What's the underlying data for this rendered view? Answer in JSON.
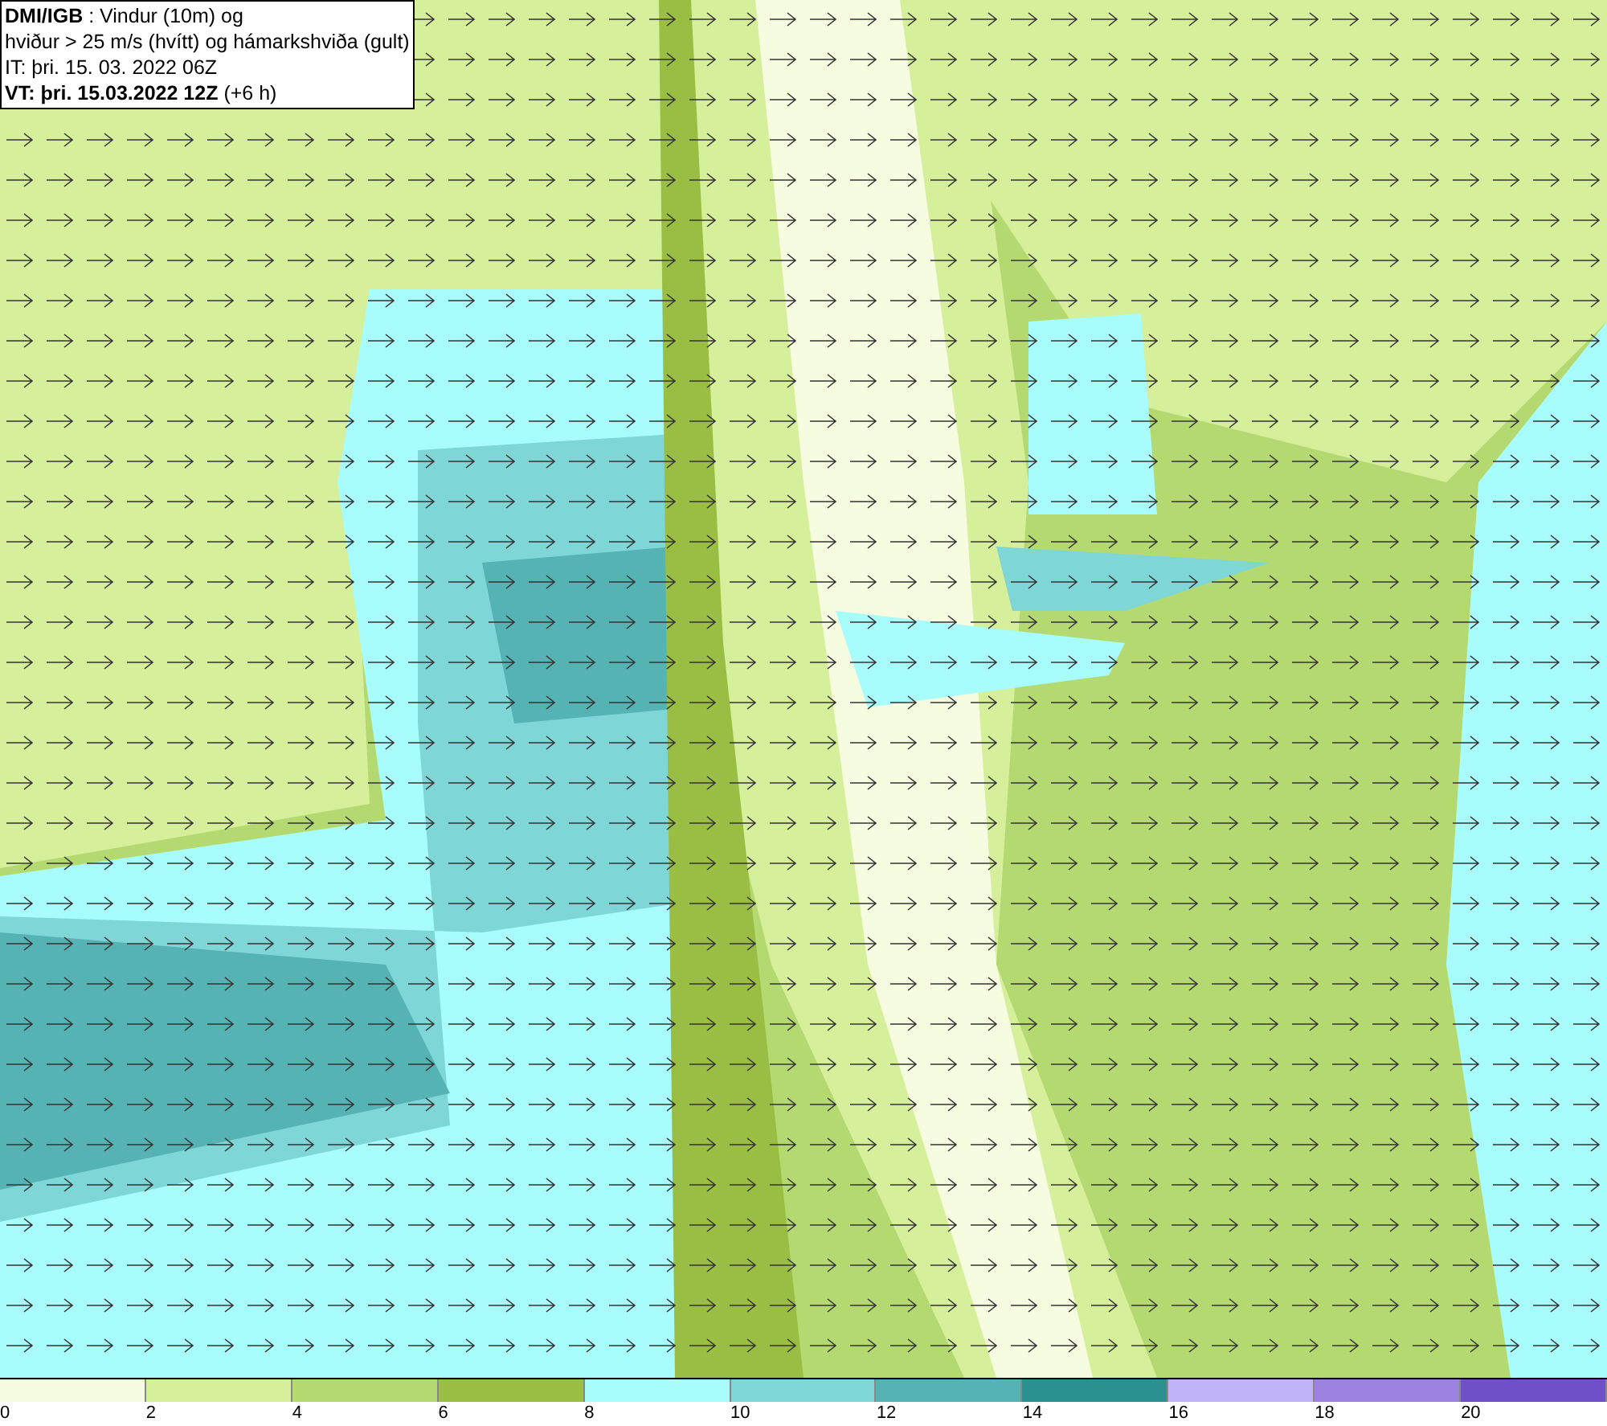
{
  "header": {
    "lines": [
      "**DMI/IGB** : Vindur (10m) og",
      "hviður > 25 m/s (hvítt) og hámarkshviða (gult)",
      "IT: þri. 15. 03. 2022 06Z",
      "**VT: þri. 15.03.2022 12Z** (+6 h)"
    ]
  },
  "legend": [
    {
      "label": "0",
      "color": "#f5fce0"
    },
    {
      "label": "2",
      "color": "#d6ef9a"
    },
    {
      "label": "4",
      "color": "#b5d971"
    },
    {
      "label": "6",
      "color": "#9abd44"
    },
    {
      "label": "8",
      "color": "#a8fcfc"
    },
    {
      "label": "10",
      "color": "#7fd6d6"
    },
    {
      "label": "12",
      "color": "#55b3b3"
    },
    {
      "label": "14",
      "color": "#2a9090"
    },
    {
      "label": "16",
      "color": "#c2b2f7"
    },
    {
      "label": "18",
      "color": "#9b82e0"
    },
    {
      "label": "20",
      "color": "#7050c8"
    }
  ]
}
